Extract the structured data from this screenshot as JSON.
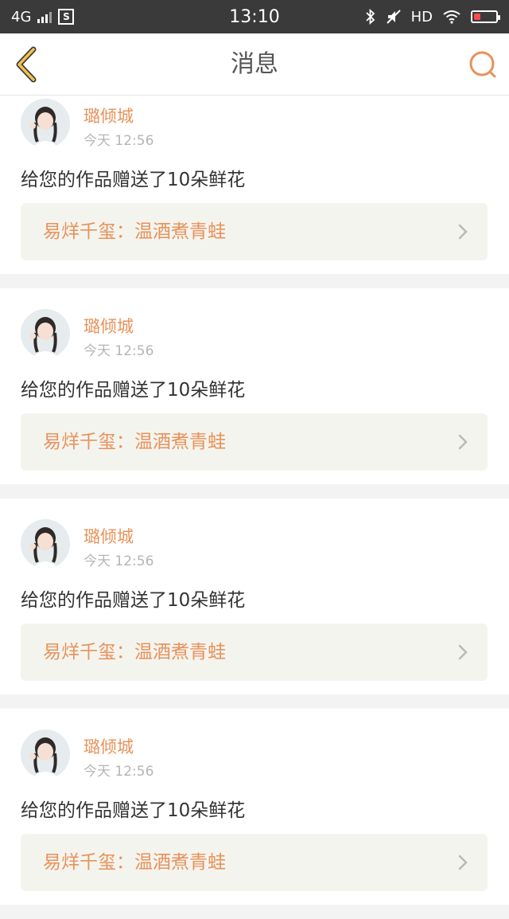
{
  "status_bar": {
    "network": "4G",
    "time": "13:10",
    "hd": "HD",
    "icons": [
      "signal-icon",
      "s-app-icon",
      "bluetooth-icon",
      "mute-icon",
      "wifi-icon",
      "battery-icon"
    ]
  },
  "nav": {
    "title": "消息",
    "back_icon": "back-chevron-icon",
    "search_icon": "search-icon"
  },
  "colors": {
    "accent": "#e8925a",
    "back": "#f2c14e",
    "text": "#333333",
    "muted": "#b5b5b5",
    "work_bg": "#f4f4ef"
  },
  "messages": [
    {
      "user": "璐倾城",
      "time": "今天 12:56",
      "text": "给您的作品赠送了10朵鲜花",
      "work": "易烊千玺：温酒煮青蛙"
    },
    {
      "user": "璐倾城",
      "time": "今天 12:56",
      "text": "给您的作品赠送了10朵鲜花",
      "work": "易烊千玺：温酒煮青蛙"
    },
    {
      "user": "璐倾城",
      "time": "今天 12:56",
      "text": "给您的作品赠送了10朵鲜花",
      "work": "易烊千玺：温酒煮青蛙"
    },
    {
      "user": "璐倾城",
      "time": "今天 12:56",
      "text": "给您的作品赠送了10朵鲜花",
      "work": "易烊千玺：温酒煮青蛙"
    }
  ]
}
